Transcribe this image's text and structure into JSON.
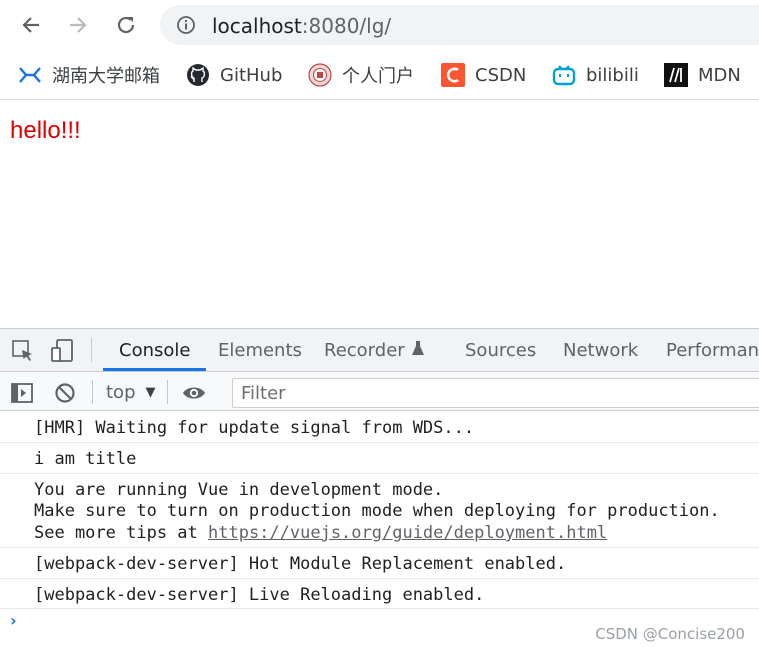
{
  "browser": {
    "url_host": "localhost",
    "url_rest": ":8080/lg/",
    "bookmarks": [
      {
        "label": "湖南大学邮箱",
        "icon": "mail-logo-icon"
      },
      {
        "label": "GitHub",
        "icon": "github-icon"
      },
      {
        "label": "个人门户",
        "icon": "university-seal-icon"
      },
      {
        "label": "CSDN",
        "icon": "csdn-icon"
      },
      {
        "label": "bilibili",
        "icon": "bilibili-icon"
      },
      {
        "label": "MDN",
        "icon": "mdn-icon"
      }
    ]
  },
  "page": {
    "text": "hello!!!",
    "text_color": "#e00000"
  },
  "devtools": {
    "tabs": [
      "Console",
      "Elements",
      "Recorder",
      "Sources",
      "Network",
      "Performance"
    ],
    "active_tab": "Console",
    "context": "top",
    "filter_placeholder": "Filter",
    "messages": [
      {
        "lines": [
          "[HMR] Waiting for update signal from WDS..."
        ]
      },
      {
        "lines": [
          "i am title"
        ]
      },
      {
        "lines": [
          "You are running Vue in development mode.",
          "Make sure to turn on production mode when deploying for production.",
          "See more tips at "
        ],
        "link": "https://vuejs.org/guide/deployment.html"
      },
      {
        "lines": [
          "[webpack-dev-server] Hot Module Replacement enabled."
        ]
      },
      {
        "lines": [
          "[webpack-dev-server] Live Reloading enabled."
        ]
      }
    ],
    "prompt": "›"
  },
  "watermark": "CSDN @Concise200",
  "colors": {
    "accent": "#1a73e8",
    "csdn": "#fc5531",
    "bilibili": "#00a1d6"
  }
}
